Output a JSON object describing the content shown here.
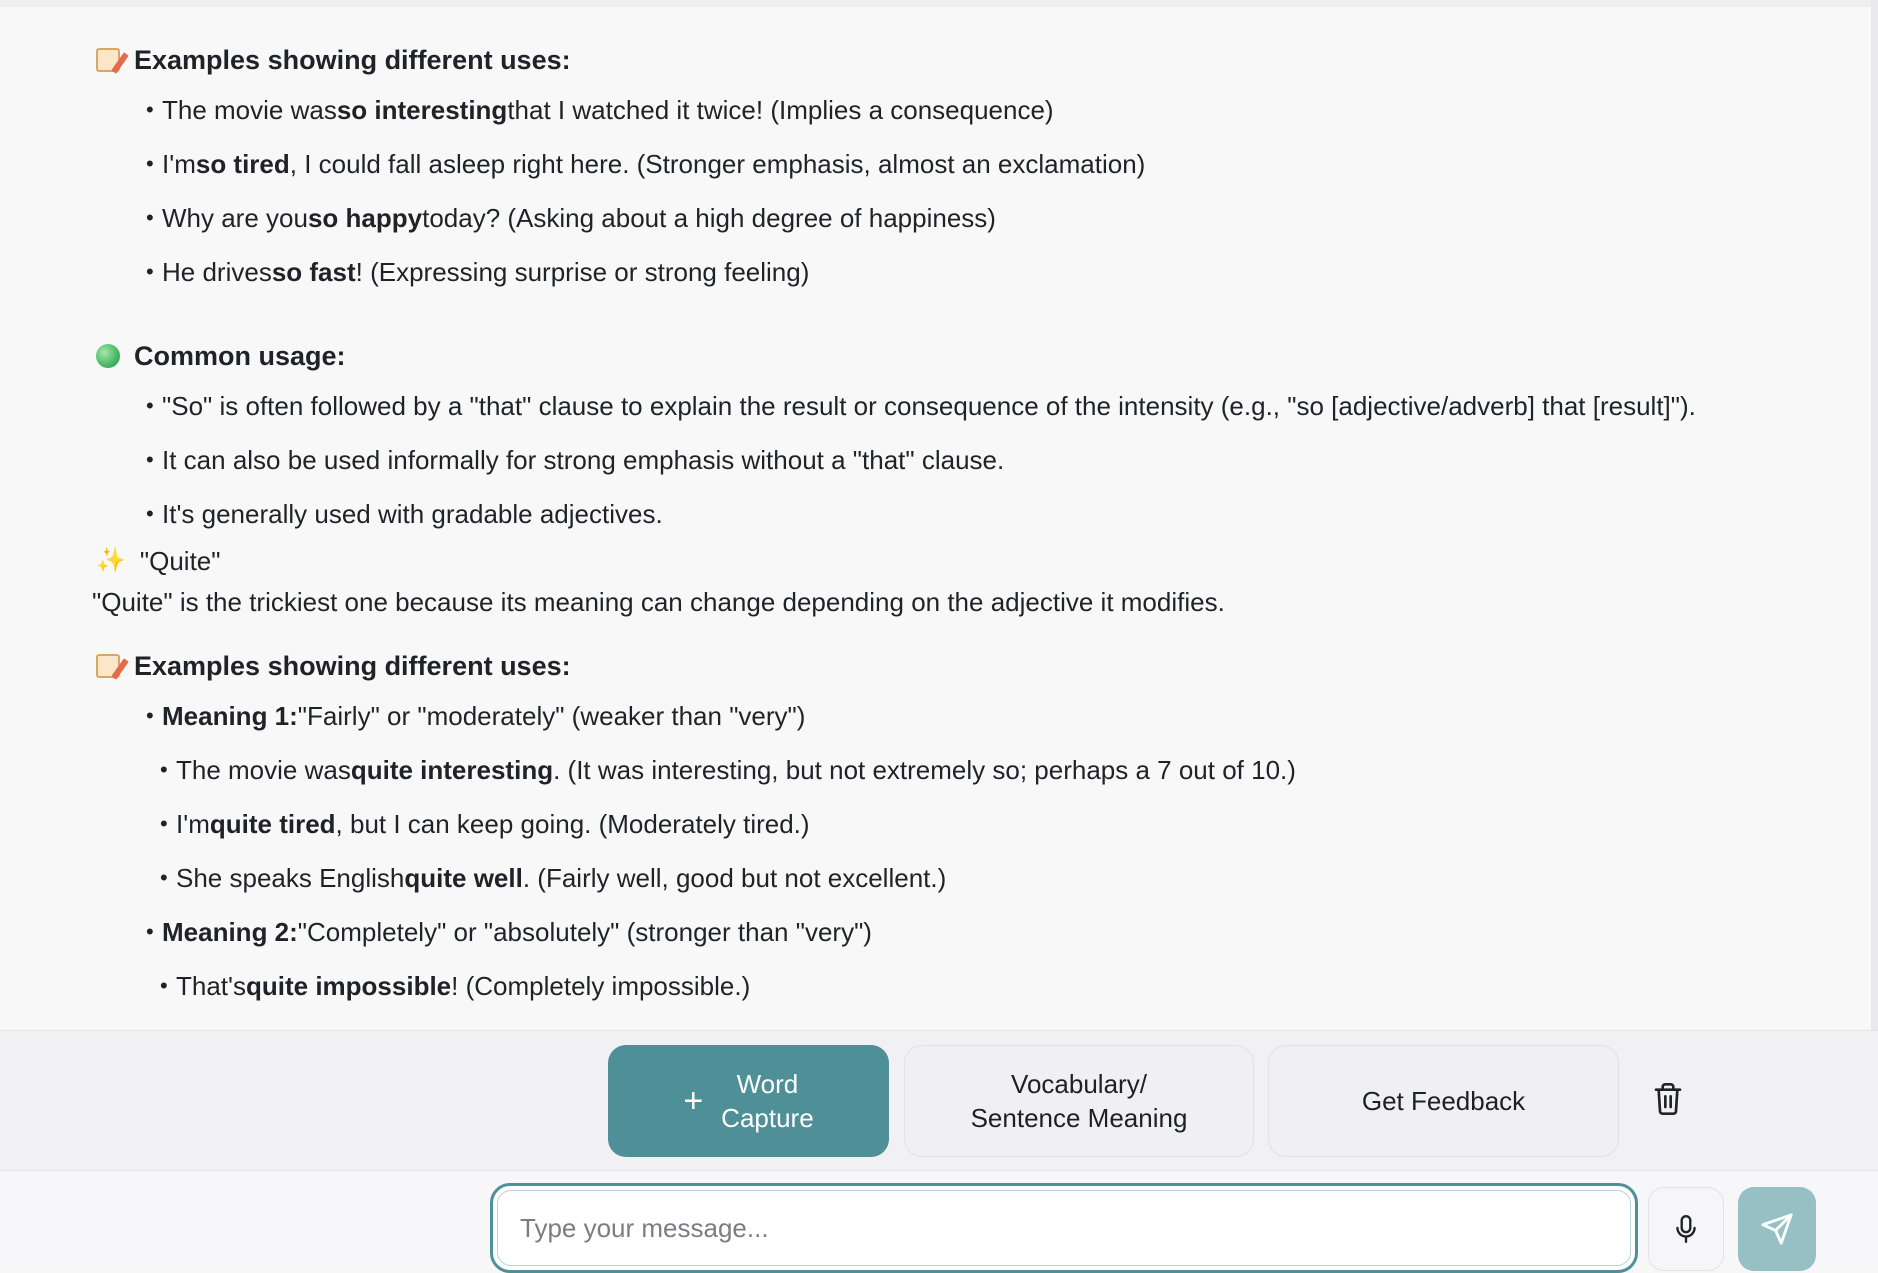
{
  "chat": {
    "section1": {
      "heading": "Examples showing different uses:",
      "items": [
        [
          "The movie was ",
          "so interesting",
          " that I watched it twice! (Implies a consequence)"
        ],
        [
          "I'm ",
          "so tired",
          ", I could fall asleep right here. (Stronger emphasis, almost an exclamation)"
        ],
        [
          "Why are you ",
          "so happy",
          " today? (Asking about a high degree of happiness)"
        ],
        [
          "He drives ",
          "so fast",
          "! (Expressing surprise or strong feeling)"
        ]
      ]
    },
    "section2": {
      "heading": "Common usage:",
      "items": [
        "\"So\" is often followed by a \"that\" clause to explain the result or consequence of the intensity (e.g., \"so [adjective/adverb] that [result]\").",
        "It can also be used informally for strong emphasis without a \"that\" clause.",
        "It's generally used with gradable adjectives."
      ]
    },
    "quite": {
      "title": "\"Quite\"",
      "intro": "\"Quite\" is the trickiest one because its meaning can change depending on the adjective it modifies."
    },
    "section3": {
      "heading": "Examples showing different uses:",
      "meaning1_label": "Meaning 1:",
      "meaning1_text": " \"Fairly\" or \"moderately\" (weaker than \"very\")",
      "meaning1_items": [
        [
          "The movie was ",
          "quite interesting",
          ". (It was interesting, but not extremely so; perhaps a 7 out of 10.)"
        ],
        [
          "I'm ",
          "quite tired",
          ", but I can keep going. (Moderately tired.)"
        ],
        [
          "She speaks English ",
          "quite well",
          ". (Fairly well, good but not excellent.)"
        ]
      ],
      "meaning2_label": "Meaning 2:",
      "meaning2_text": " \"Completely\" or \"absolutely\" (stronger than \"very\")",
      "meaning2_items": [
        [
          "That's ",
          "quite impossible",
          "! (Completely impossible.)"
        ]
      ]
    }
  },
  "actions": {
    "word_capture_line1": "Word",
    "word_capture_line2": "Capture",
    "vocab_line1": "Vocabulary/",
    "vocab_line2": "Sentence Meaning",
    "feedback": "Get Feedback"
  },
  "composer": {
    "placeholder": "Type your message..."
  },
  "icons": {
    "memo": "memo-icon",
    "green_circle": "green-circle-icon",
    "sparkles": "sparkles-icon",
    "plus": "plus-icon",
    "trash": "trash-icon",
    "mic": "microphone-icon",
    "send": "send-icon"
  },
  "colors": {
    "accent": "#4f8f98",
    "send_disabled": "#96c0c4"
  }
}
